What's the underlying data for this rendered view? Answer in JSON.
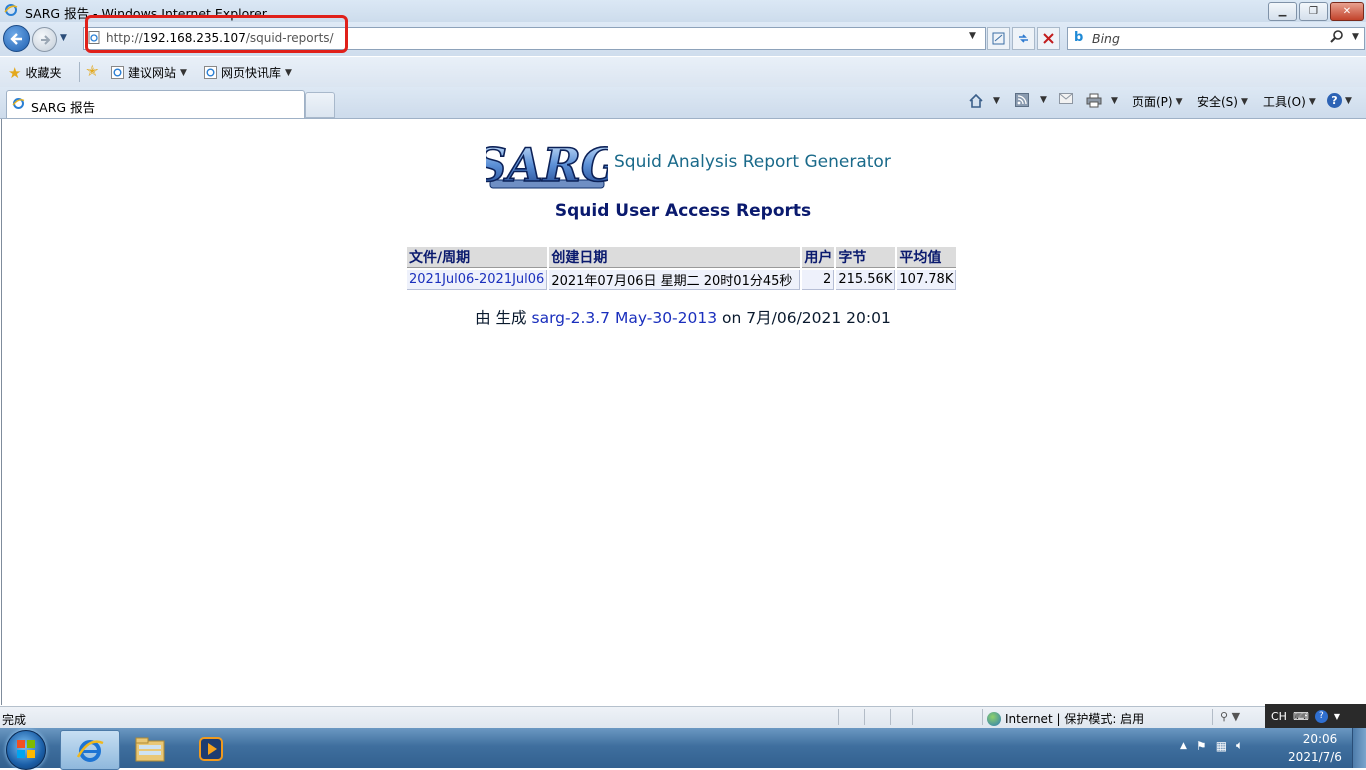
{
  "window": {
    "title": "SARG 报告 - Windows Internet Explorer"
  },
  "navbar": {
    "url_scheme": "http://",
    "url_host": "192.168.235.107",
    "url_path": "/squid-reports/",
    "search_placeholder": "Bing"
  },
  "favorites": {
    "favorites_label": "收藏夹",
    "items": [
      {
        "label": "建议网站"
      },
      {
        "label": "网页快讯库"
      }
    ]
  },
  "tab": {
    "label": "SARG 报告"
  },
  "commands": {
    "page": "页面(P)",
    "safety": "安全(S)",
    "tools": "工具(O)"
  },
  "page": {
    "logo_text": "SARG",
    "logo_title": "Squid Analysis Report Generator",
    "report_title": "Squid User Access Reports",
    "table": {
      "headers": [
        "文件/周期",
        "创建日期",
        "用户",
        "字节",
        "平均值"
      ],
      "rows": [
        [
          "2021Jul06-2021Jul06",
          "2021年07月06日 星期二 20时01分45秒",
          "2",
          "215.56K",
          "107.78K"
        ]
      ]
    },
    "generated_prefix": "由 生成",
    "generated_link": "sarg-2.3.7 May-30-2013",
    "generated_suffix": "on 7月/06/2021 20:01"
  },
  "statusbar": {
    "status": "完成",
    "zone": "Internet | 保护模式: 启用",
    "ime": "CH"
  },
  "taskbar": {
    "clock_time": "20:06",
    "clock_date": "2021/7/6"
  },
  "colors": {
    "highlight": "#e0201a",
    "report_title": "#0a1a6e",
    "link": "#1a2fbd"
  }
}
